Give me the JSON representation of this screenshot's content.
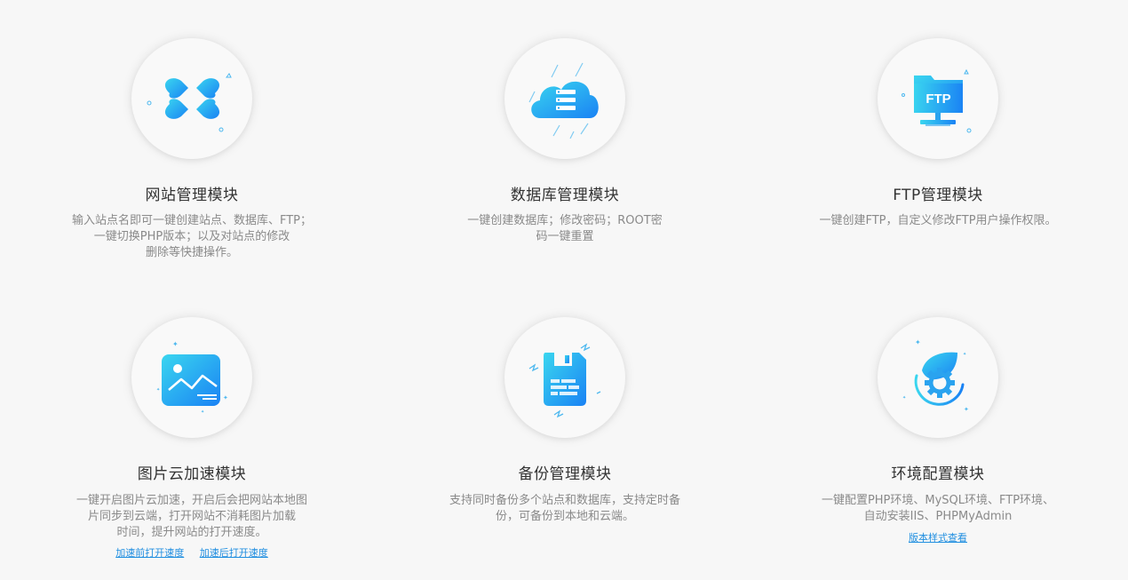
{
  "modules": [
    {
      "title": "网站管理模块",
      "desc": [
        "输入站点名即可一键创建站点、数据库、FTP；",
        "一键切换PHP版本；以及对站点的修改",
        "删除等快捷操作。"
      ]
    },
    {
      "title": "数据库管理模块",
      "desc": [
        "一键创建数据库；修改密码；ROOT密",
        "码一键重置"
      ]
    },
    {
      "title": "FTP管理模块",
      "desc": [
        "一键创建FTP，自定义修改FTP用户操作权限。"
      ],
      "icon_text": "FTP"
    },
    {
      "title": "图片云加速模块",
      "desc": [
        "一键开启图片云加速，开启后会把网站本地图",
        "片同步到云端，打开网站不消耗图片加载",
        "时间，提升网站的打开速度。"
      ],
      "links": [
        "加速前打开速度",
        "加速后打开速度"
      ]
    },
    {
      "title": "备份管理模块",
      "desc": [
        "支持同时备份多个站点和数据库，支持定时备",
        "份，可备份到本地和云端。"
      ]
    },
    {
      "title": "环境配置模块",
      "desc": [
        "一键配置PHP环境、MySQL环境、FTP环境、",
        "自动安装IIS、PHPMyAdmin"
      ],
      "links": [
        "版本样式查看"
      ]
    }
  ],
  "colors": {
    "accent_start": "#32d3f0",
    "accent_end": "#1a87f5",
    "link": "#1f8ee0",
    "title": "#333333",
    "desc": "#8a8a8a"
  }
}
